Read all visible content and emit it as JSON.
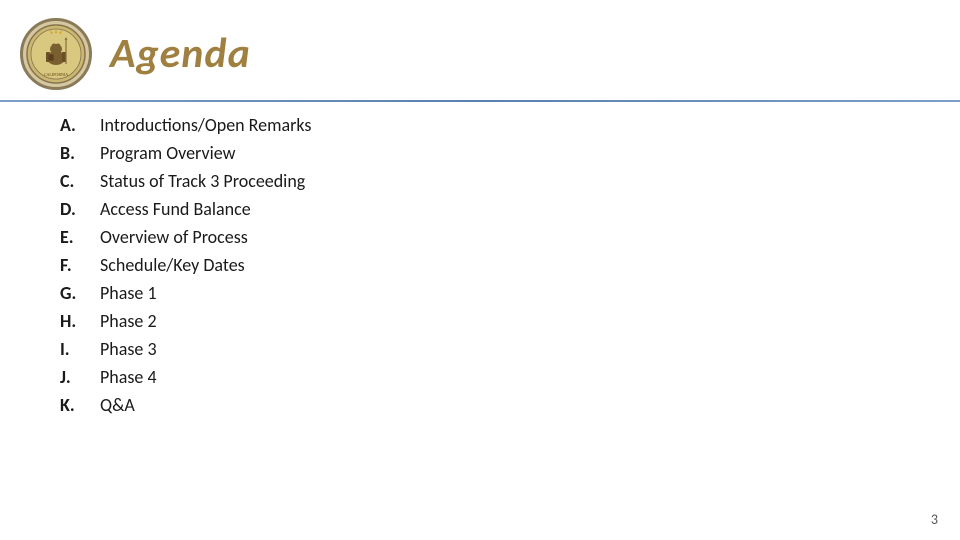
{
  "header": {
    "title": "Agenda",
    "page_number": "3"
  },
  "agenda": {
    "items": [
      {
        "letter": "A.",
        "text": "Introductions/Open Remarks"
      },
      {
        "letter": "B.",
        "text": "Program Overview"
      },
      {
        "letter": "C.",
        "text": "Status of Track 3 Proceeding"
      },
      {
        "letter": "D.",
        "text": "Access Fund Balance"
      },
      {
        "letter": "E.",
        "text": "Overview of Process"
      },
      {
        "letter": "F.",
        "text": "Schedule/Key Dates"
      },
      {
        "letter": "G.",
        "text": "Phase 1"
      },
      {
        "letter": "H.",
        "text": "Phase 2"
      },
      {
        "letter": "I.",
        "text": "Phase 3"
      },
      {
        "letter": "J.",
        "text": "Phase 4"
      },
      {
        "letter": "K.",
        "text": "Q&A"
      }
    ]
  }
}
